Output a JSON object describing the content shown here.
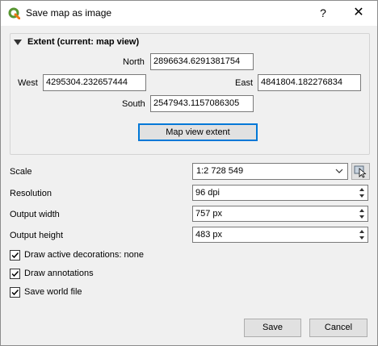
{
  "window": {
    "title": "Save map as image"
  },
  "titlebar": {
    "help": "?",
    "close": "✕"
  },
  "extent": {
    "title": "Extent (current: map view)",
    "north_label": "North",
    "north_value": "2896634.6291381754",
    "west_label": "West",
    "west_value": "4295304.232657444",
    "east_label": "East",
    "east_value": "4841804.182276834",
    "south_label": "South",
    "south_value": "2547943.1157086305",
    "map_view_button": "Map view extent"
  },
  "settings": {
    "scale_label": "Scale",
    "scale_value": "1:2 728 549",
    "resolution_label": "Resolution",
    "resolution_value": "96 dpi",
    "output_width_label": "Output width",
    "output_width_value": "757 px",
    "output_height_label": "Output height",
    "output_height_value": "483 px"
  },
  "checkboxes": [
    {
      "label": "Draw active decorations: none",
      "checked": true
    },
    {
      "label": "Draw annotations",
      "checked": true
    },
    {
      "label": "Save world file",
      "checked": true
    }
  ],
  "footer": {
    "save": "Save",
    "cancel": "Cancel"
  },
  "colors": {
    "accent": "#0078d7",
    "qgis_green": "#589632",
    "qgis_yellow": "#ee7913"
  }
}
